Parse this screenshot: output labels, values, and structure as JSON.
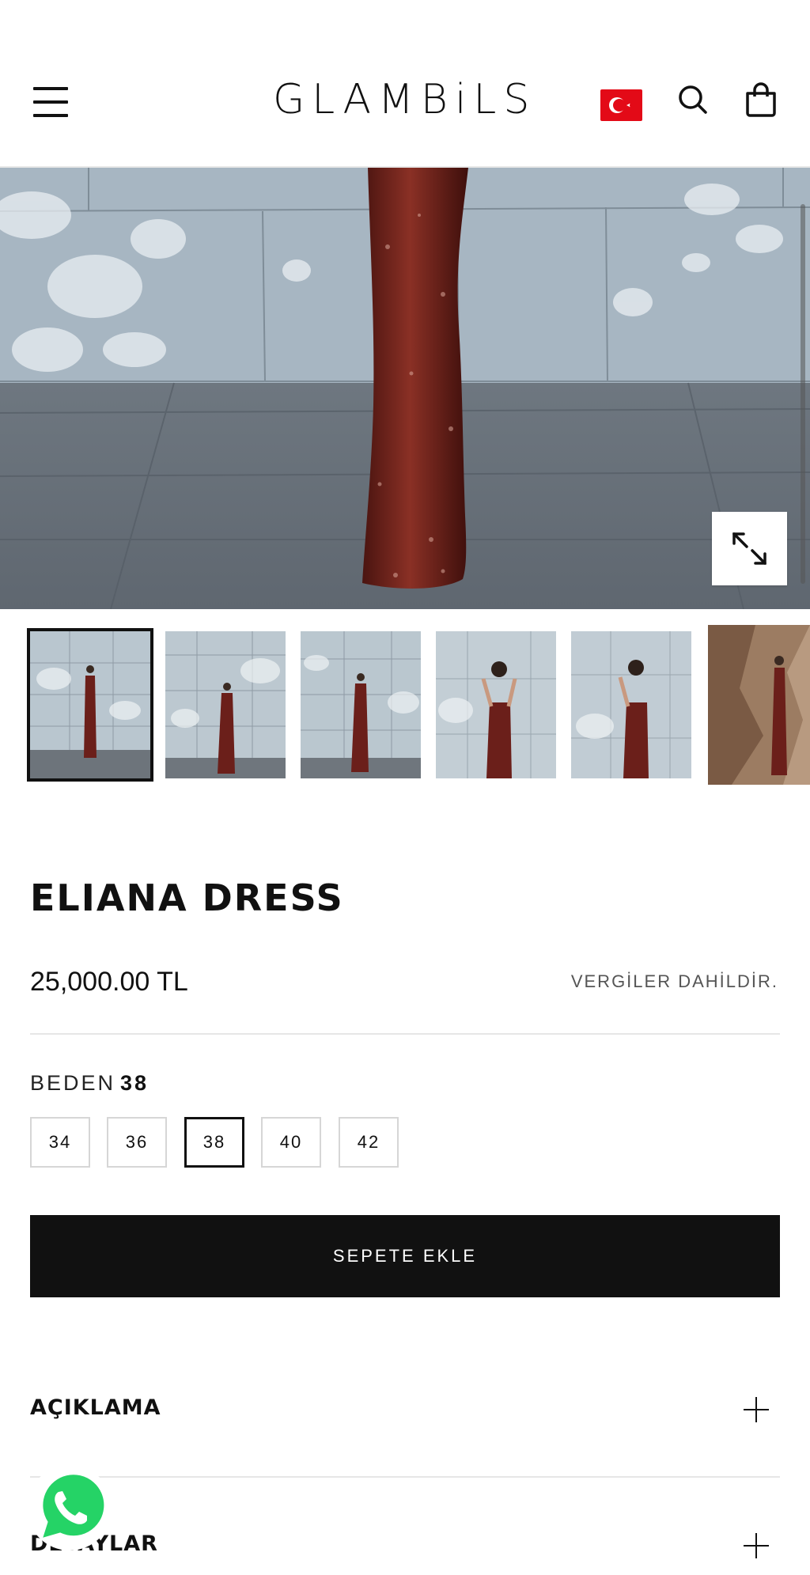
{
  "header": {
    "logo_text": "GLAMBiLS",
    "menu_icon": "hamburger-menu-icon",
    "flag_icon": "turkey-flag-icon",
    "search_icon": "search-icon",
    "cart_icon": "shopping-bag-icon"
  },
  "gallery": {
    "expand_icon": "expand-icon",
    "thumbnail_count": 6,
    "active_thumbnail": 1
  },
  "product": {
    "title": "ELIANA DRESS",
    "price": "25,000.00 TL",
    "tax_note": "VERGİLER DAHİLDİR.",
    "size_label": "BEDEN",
    "selected_size": "38",
    "sizes": [
      "34",
      "36",
      "38",
      "40",
      "42"
    ],
    "add_to_cart": "SEPETE EKLE"
  },
  "accordion": {
    "items": [
      {
        "label": "AÇIKLAMA"
      },
      {
        "label": "DETAYLAR"
      }
    ]
  },
  "whatsapp": {
    "icon": "whatsapp-icon"
  },
  "colors": {
    "accent": "#111111",
    "flag_red": "#e30a17",
    "dress": "#6b1f1a",
    "whatsapp_green": "#25d366"
  }
}
